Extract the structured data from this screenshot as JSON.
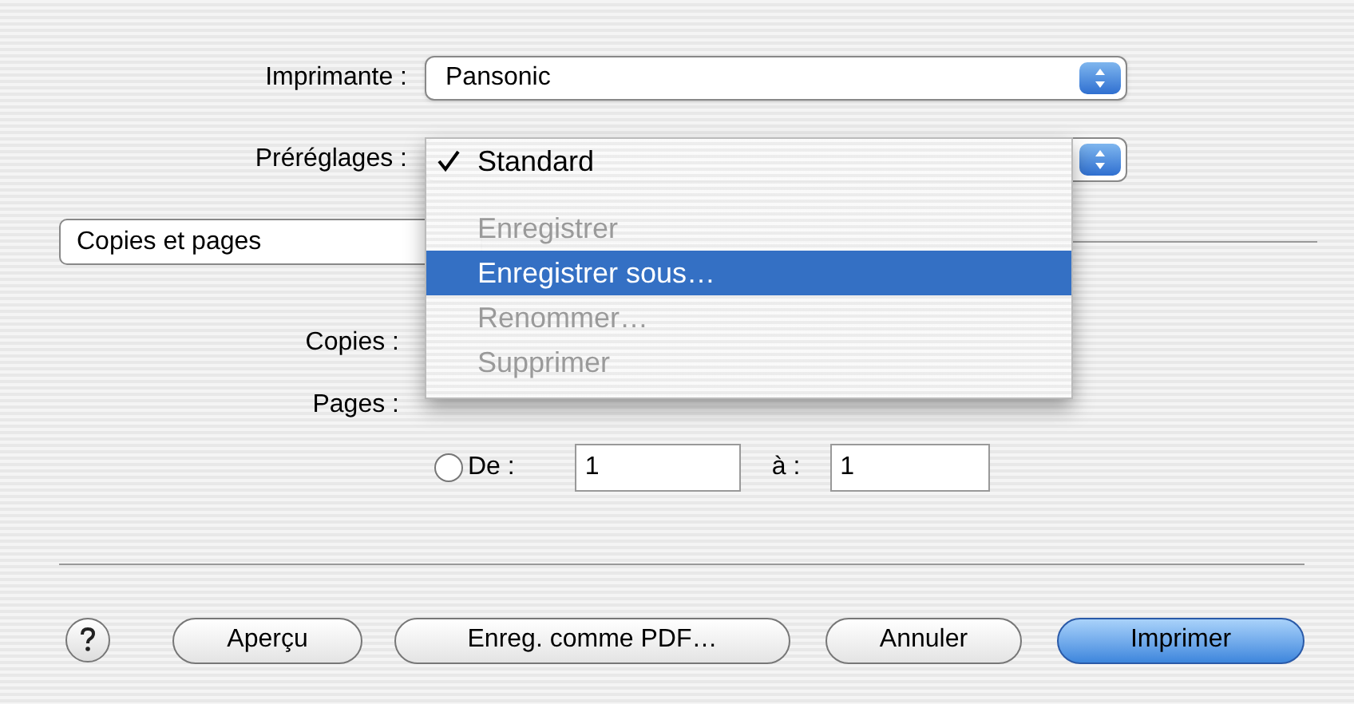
{
  "printer": {
    "label": "Imprimante :",
    "value": "Pansonic"
  },
  "presets": {
    "label": "Préréglages :"
  },
  "presets_menu": [
    {
      "label": "Standard",
      "checked": true,
      "disabled": false,
      "selected": false,
      "separator_after": true
    },
    {
      "label": "Enregistrer",
      "checked": false,
      "disabled": true,
      "selected": false,
      "separator_after": false
    },
    {
      "label": "Enregistrer sous…",
      "checked": false,
      "disabled": false,
      "selected": true,
      "separator_after": false
    },
    {
      "label": "Renommer…",
      "checked": false,
      "disabled": true,
      "selected": false,
      "separator_after": false
    },
    {
      "label": "Supprimer",
      "checked": false,
      "disabled": true,
      "selected": false,
      "separator_after": false
    }
  ],
  "panel": {
    "value": "Copies et pages"
  },
  "copies": {
    "label": "Copies :"
  },
  "pages": {
    "label": "Pages :",
    "from": {
      "label": "De :",
      "selected": false,
      "value": "1"
    },
    "to": {
      "label": "à :",
      "value": "1"
    }
  },
  "buttons": [
    {
      "label": "Aperçu",
      "default": false
    },
    {
      "label": "Enreg. comme PDF…",
      "default": false
    },
    {
      "label": "Annuler",
      "default": false
    },
    {
      "label": "Imprimer",
      "default": true
    }
  ]
}
